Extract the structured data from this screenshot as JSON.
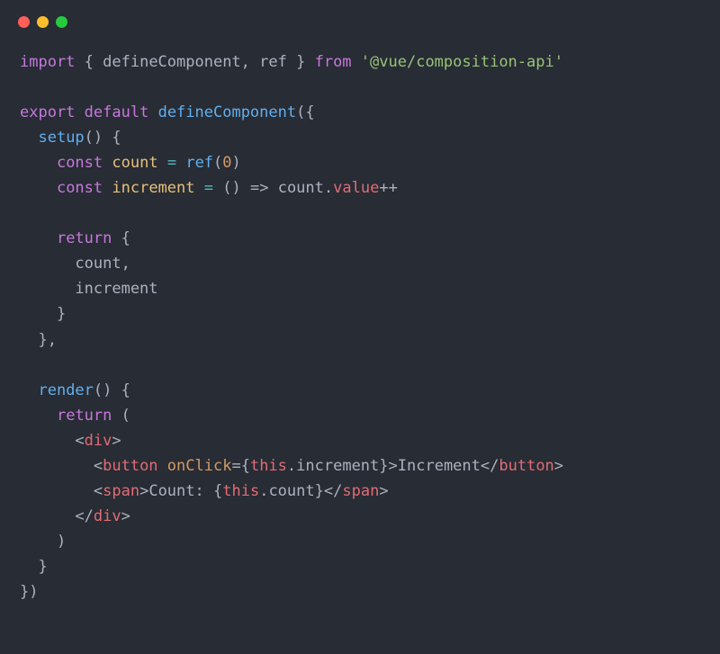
{
  "code": {
    "l1_import": "import",
    "l1_brace_open": " { ",
    "l1_defineComponent": "defineComponent",
    "l1_comma1": ", ",
    "l1_ref": "ref",
    "l1_brace_close": " } ",
    "l1_from": "from",
    "l1_sp": " ",
    "l1_string": "'@vue/composition-api'",
    "l3_export": "export",
    "l3_sp1": " ",
    "l3_default": "default",
    "l3_sp2": " ",
    "l3_defineComponent": "defineComponent",
    "l3_paren": "({",
    "l4_indent": "  ",
    "l4_setup": "setup",
    "l4_paren": "() {",
    "l5_indent": "    ",
    "l5_const": "const",
    "l5_sp1": " ",
    "l5_count": "count",
    "l5_sp2": " ",
    "l5_eq": "=",
    "l5_sp3": " ",
    "l5_ref": "ref",
    "l5_paren_open": "(",
    "l5_zero": "0",
    "l5_paren_close": ")",
    "l6_indent": "    ",
    "l6_const": "const",
    "l6_sp1": " ",
    "l6_increment": "increment",
    "l6_sp2": " ",
    "l6_eq": "=",
    "l6_sp3": " ",
    "l6_arrow": "() =>",
    "l6_sp4": " ",
    "l6_count": "count",
    "l6_dot": ".",
    "l6_value": "value",
    "l6_pp": "++",
    "l8_indent": "    ",
    "l8_return": "return",
    "l8_brace": " {",
    "l9": "      count,",
    "l10": "      increment",
    "l11": "    }",
    "l12": "  },",
    "l14_indent": "  ",
    "l14_render": "render",
    "l14_paren": "() {",
    "l15_indent": "    ",
    "l15_return": "return",
    "l15_paren": " (",
    "l16_indent": "      <",
    "l16_div": "div",
    "l16_close": ">",
    "l17_indent": "        <",
    "l17_button": "button",
    "l17_sp": " ",
    "l17_onClick": "onClick",
    "l17_eq": "=",
    "l17_brace_open": "{",
    "l17_this": "this",
    "l17_dot": ".",
    "l17_increment": "increment",
    "l17_brace_close": "}>",
    "l17_text": "Increment",
    "l17_close_open": "</",
    "l17_button2": "button",
    "l17_close": ">",
    "l18_indent": "        <",
    "l18_span": "span",
    "l18_close1": ">",
    "l18_text1": "Count: ",
    "l18_brace_open": "{",
    "l18_this": "this",
    "l18_dot": ".",
    "l18_count": "count",
    "l18_brace_close": "}",
    "l18_close_open": "</",
    "l18_span2": "span",
    "l18_close2": ">",
    "l19_indent": "      </",
    "l19_div": "div",
    "l19_close": ">",
    "l20": "    )",
    "l21": "  }",
    "l22": "})"
  }
}
